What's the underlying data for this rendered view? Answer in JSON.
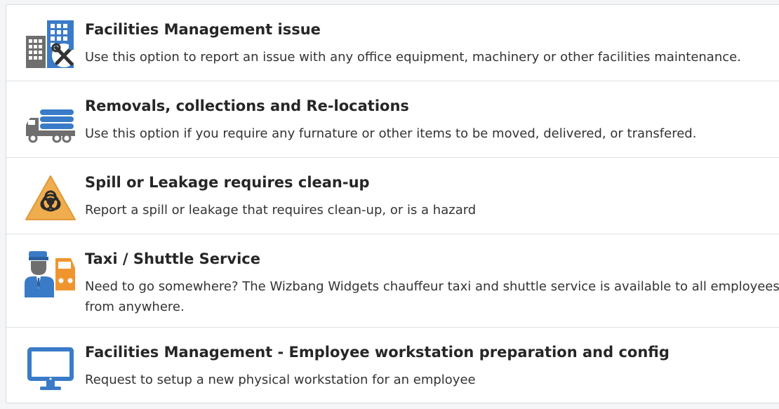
{
  "catalog": {
    "items": [
      {
        "title": "Facilities Management issue",
        "description": "Use this option to report an issue with any office equipment, machinery or other facilities maintenance.",
        "icon": "building-tools-icon"
      },
      {
        "title": "Removals, collections and Re-locations",
        "description": "Use this option if you require any furnature or other items to be moved, delivered, or transfered.",
        "icon": "truck-icon"
      },
      {
        "title": "Spill or Leakage requires clean-up",
        "description": "Report a spill or leakage that requires clean-up, or is a hazard",
        "icon": "biohazard-warning-icon"
      },
      {
        "title": "Taxi / Shuttle Service",
        "description": "Need to go somewhere? The Wizbang Widgets chauffeur taxi and shuttle service is available to all employees from anywhere.",
        "icon": "chauffeur-car-icon"
      },
      {
        "title": "Facilities Management - Employee workstation preparation and config",
        "description": "Request to setup a new physical workstation for an employee",
        "icon": "monitor-icon"
      }
    ]
  },
  "colors": {
    "icon_blue": "#3a7bc8",
    "icon_gray": "#6b6b6b",
    "warning_orange": "#f0ad4e"
  }
}
